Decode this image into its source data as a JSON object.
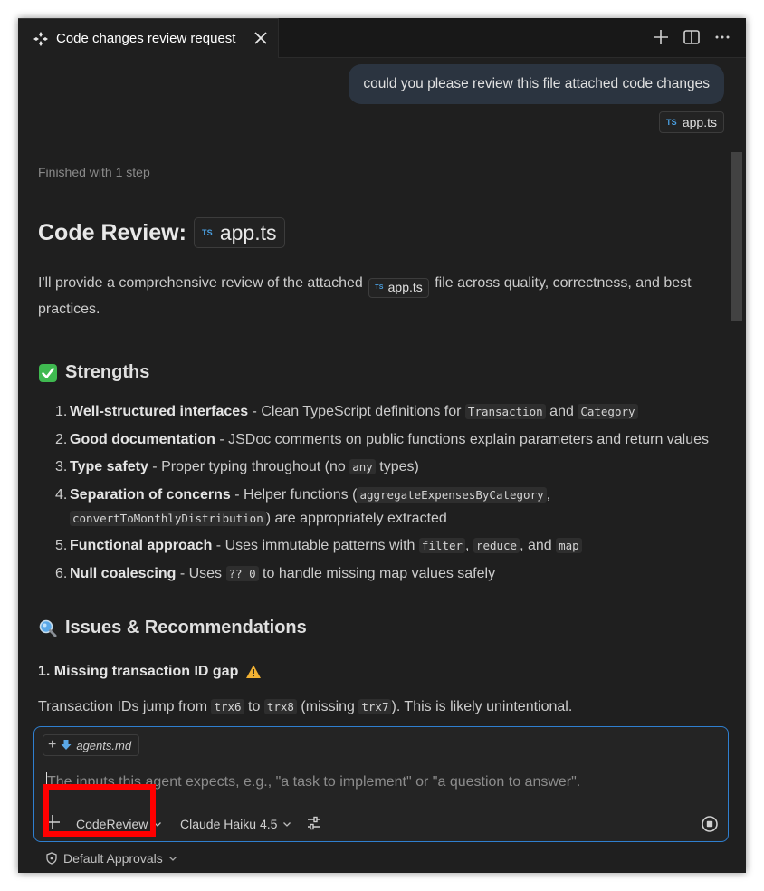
{
  "tab": {
    "title": "Code changes review request"
  },
  "user_message": {
    "text": "could you please review this file attached code changes",
    "attachment": "app.ts",
    "attachment_badge": "TS"
  },
  "response": {
    "status": "Finished with 1 step",
    "title": "Code Review:",
    "title_file": "app.ts",
    "intro_before": "I'll provide a comprehensive review of the attached",
    "intro_file": "app.ts",
    "intro_after": "file across quality, correctness, and best practices.",
    "strengths_heading": "Strengths",
    "strengths": [
      {
        "n": "1.",
        "title": "Well-structured interfaces",
        "t1": " - Clean TypeScript definitions for ",
        "c1": "Transaction",
        "t2": " and ",
        "c2": "Category",
        "t3": ""
      },
      {
        "n": "2.",
        "title": "Good documentation",
        "t1": " - JSDoc comments on public functions explain parameters and return values"
      },
      {
        "n": "3.",
        "title": "Type safety",
        "t1": " - Proper typing throughout (no ",
        "c1": "any",
        "t2": " types)"
      },
      {
        "n": "4.",
        "title": "Separation of concerns",
        "t1": " - Helper functions (",
        "c1": "aggregateExpensesByCategory",
        "t2": ", ",
        "c2": "convertToMonthlyDistribution",
        "t3": ") are appropriately extracted"
      },
      {
        "n": "5.",
        "title": "Functional approach",
        "t1": " - Uses immutable patterns with ",
        "c1": "filter",
        "t2": ", ",
        "c2": "reduce",
        "t3": ", and ",
        "c3": "map",
        "t4": ""
      },
      {
        "n": "6.",
        "title": "Null coalescing",
        "t1": " - Uses ",
        "c1": "?? 0",
        "t2": " to handle missing map values safely"
      }
    ],
    "issues_heading": "Issues & Recommendations",
    "issue1_title": "1. Missing transaction ID gap",
    "issue1": {
      "t1": "Transaction IDs jump from ",
      "c1": "trx6",
      "t2": " to ",
      "c2": "trx8",
      "t3": " (missing ",
      "c3": "trx7",
      "t4": "). This is likely unintentional."
    }
  },
  "input": {
    "context_file": "agents.md",
    "placeholder": "The inputs this agent expects, e.g., \"a task to implement\" or \"a question to answer\".",
    "value": "",
    "agent": "CodeReview",
    "model": "Claude Haiku 4.5",
    "approvals": "Default Approvals"
  },
  "colors": {
    "accent": "#2f7fcf",
    "highlight": "#ff0000",
    "ts_badge": "#4a9fe0"
  }
}
